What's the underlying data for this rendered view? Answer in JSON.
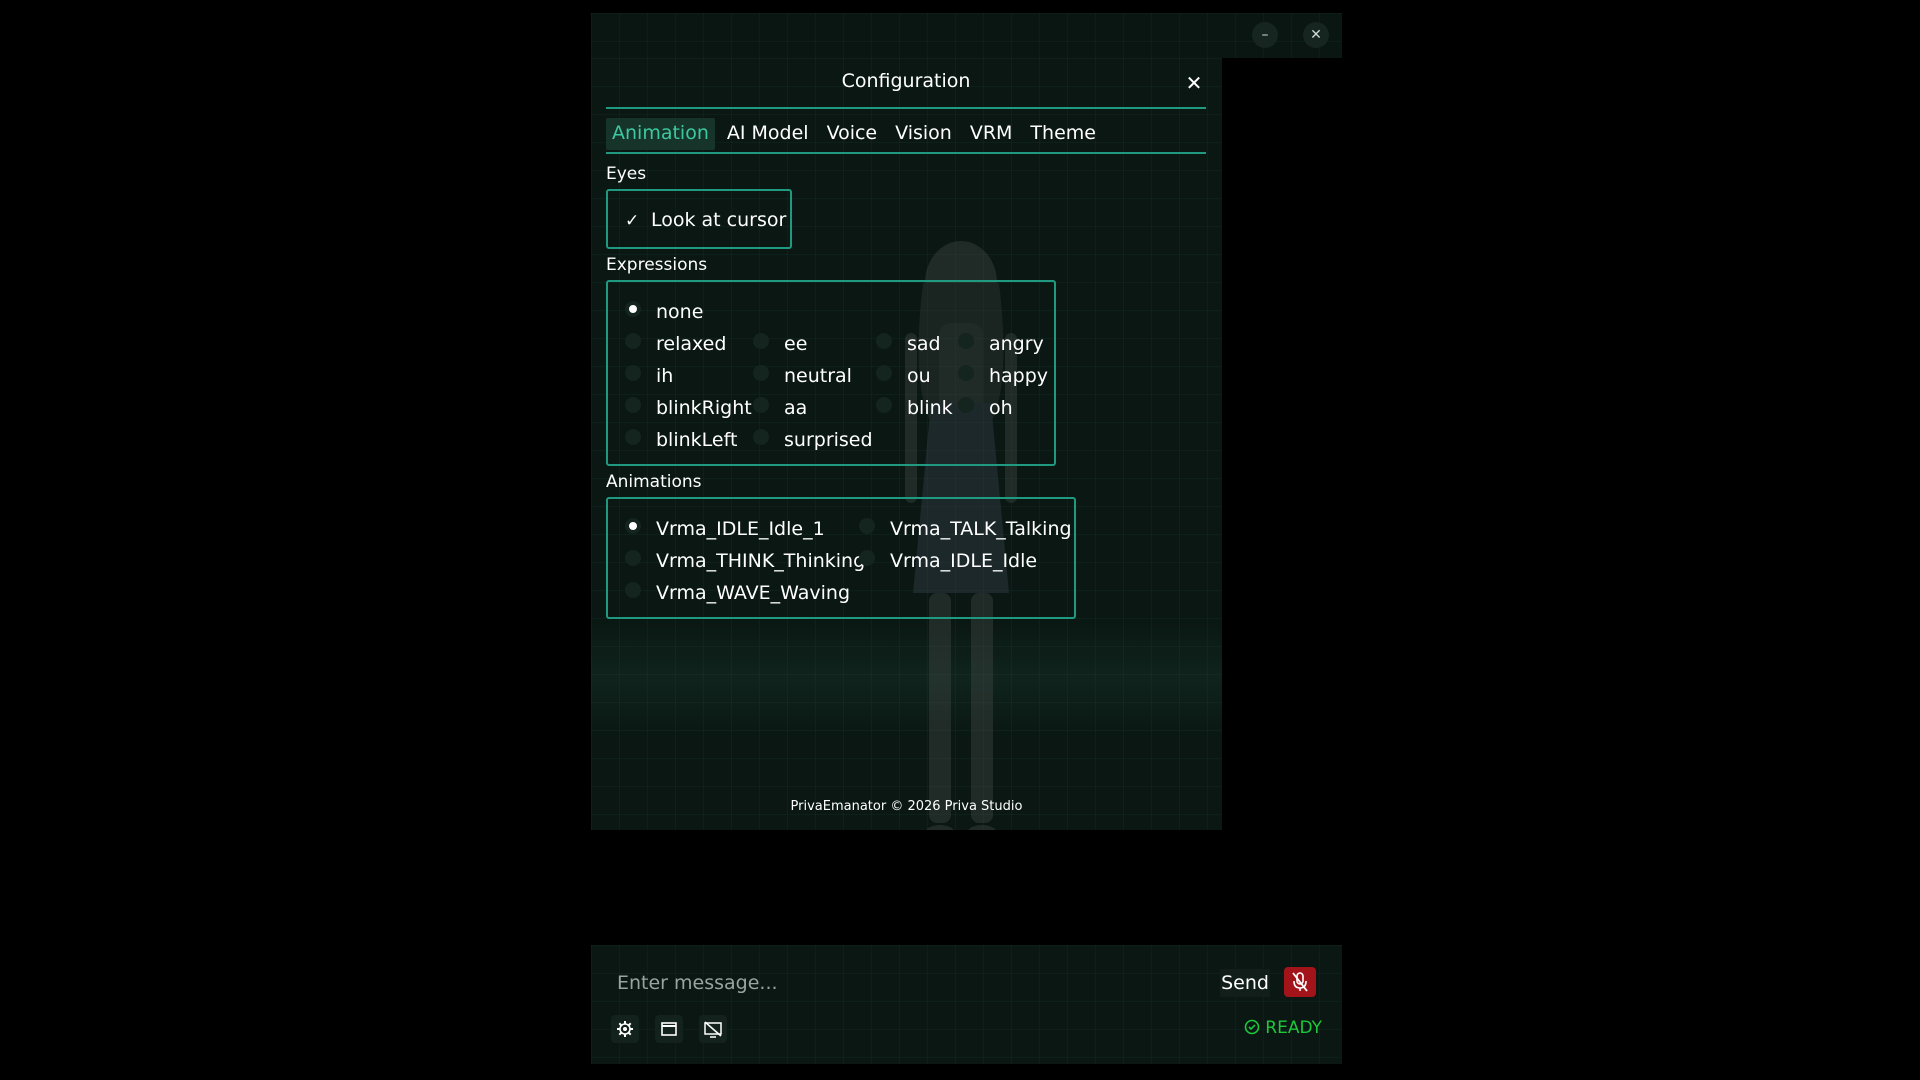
{
  "window": {
    "minimize_label": "–",
    "close_label": "✕"
  },
  "config": {
    "title": "Configuration",
    "close_label": "✕",
    "tabs": [
      "Animation",
      "AI Model",
      "Voice",
      "Vision",
      "VRM",
      "Theme"
    ],
    "active_tab": "Animation",
    "eyes": {
      "label": "Eyes",
      "look_at_cursor": {
        "label": "Look at cursor",
        "checked": true,
        "check_glyph": "✓"
      }
    },
    "expressions": {
      "label": "Expressions",
      "selected": "none",
      "options": [
        "none",
        "relaxed",
        "ee",
        "sad",
        "angry",
        "ih",
        "neutral",
        "ou",
        "happy",
        "blinkRight",
        "aa",
        "blink",
        "oh",
        "blinkLeft",
        "surprised"
      ]
    },
    "animations": {
      "label": "Animations",
      "selected": "Vrma_IDLE_Idle_1",
      "options": [
        "Vrma_IDLE_Idle_1",
        "Vrma_TALK_Talking",
        "Vrma_THINK_Thinking",
        "Vrma_IDLE_Idle",
        "Vrma_WAVE_Waving"
      ]
    }
  },
  "footer": "PrivaEmanator © 2026 Priva Studio",
  "chat": {
    "placeholder": "Enter message...",
    "send_label": "Send",
    "status": "READY",
    "icons": [
      "gear-icon",
      "window-icon",
      "no-screen-icon",
      "mic-off-icon",
      "check-circle-icon"
    ]
  },
  "colors": {
    "accent": "#1f9a80",
    "active_tab_text": "#3cc8a0",
    "ready": "#1ec83a",
    "mic": "#a3141a"
  }
}
